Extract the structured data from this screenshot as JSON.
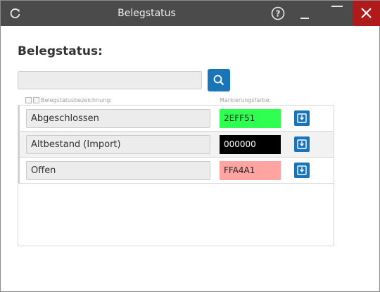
{
  "window": {
    "title": "Belegstatus"
  },
  "page": {
    "heading": "Belegstatus:"
  },
  "search": {
    "value": "",
    "placeholder": ""
  },
  "table": {
    "columns": {
      "name": "Belegstatusbezeichnung:",
      "color": "Markierungsfarbe:"
    },
    "rows": [
      {
        "name": "Abgeschlossen",
        "color": "2EFF51",
        "bg": "#2EFF51",
        "fg": "#222222"
      },
      {
        "name": "Altbestand (Import)",
        "color": "000000",
        "bg": "#000000",
        "fg": "#ffffff"
      },
      {
        "name": "Offen",
        "color": "FFA4A1",
        "bg": "#FFA4A1",
        "fg": "#222222"
      }
    ]
  },
  "colors": {
    "titlebar": "#4b4b4b",
    "close": "#b11a1a",
    "accent": "#1a74b8"
  },
  "icons": {
    "refresh": "refresh-icon",
    "help": "help-icon",
    "minimize": "minimize-icon",
    "maximize": "maximize-icon",
    "close": "close-icon",
    "search": "search-icon",
    "save": "save-icon",
    "sort_up": "sort-up-icon",
    "sort_down": "sort-down-icon"
  }
}
